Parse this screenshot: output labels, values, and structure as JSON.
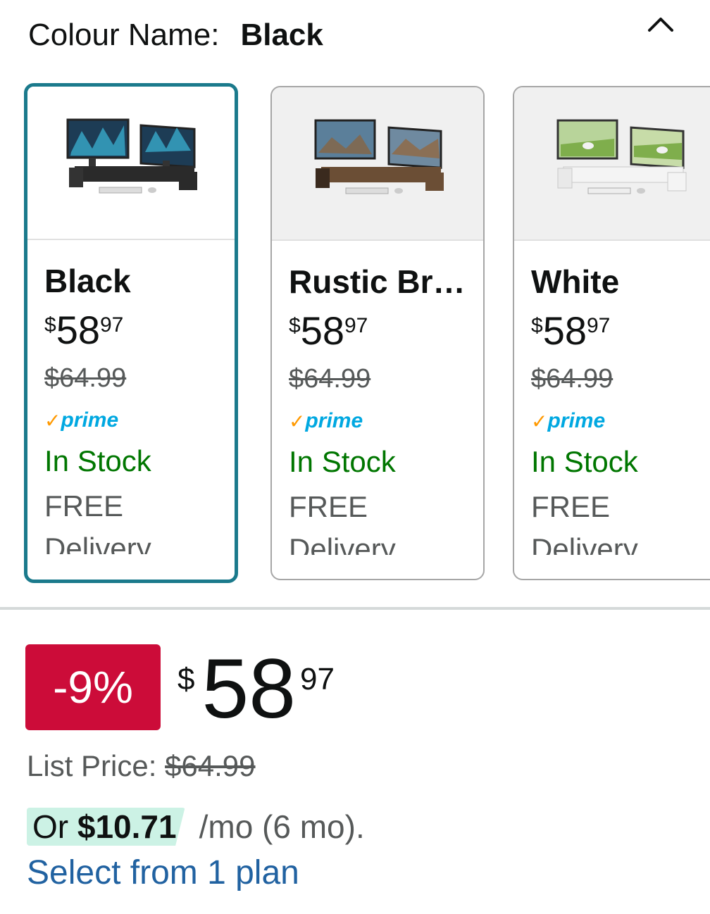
{
  "colour": {
    "label": "Colour Name:",
    "value": "Black"
  },
  "variants": [
    {
      "name": "Black",
      "price_currency": "$",
      "price_whole": "58",
      "price_fraction": "97",
      "list_price": "$64.99",
      "prime_label": "prime",
      "stock": "In Stock",
      "shipping": "FREE",
      "delivery": "Delivery"
    },
    {
      "name": "Rustic Br…",
      "price_currency": "$",
      "price_whole": "58",
      "price_fraction": "97",
      "list_price": "$64.99",
      "prime_label": "prime",
      "stock": "In Stock",
      "shipping": "FREE",
      "delivery": "Delivery"
    },
    {
      "name": "White",
      "price_currency": "$",
      "price_whole": "58",
      "price_fraction": "97",
      "list_price": "$64.99",
      "prime_label": "prime",
      "stock": "In Stock",
      "shipping": "FREE",
      "delivery": "Delivery"
    }
  ],
  "pricing": {
    "discount": "-9%",
    "currency": "$",
    "whole": "58",
    "fraction": "97",
    "list_price_label": "List Price:",
    "list_price": "$64.99"
  },
  "installment": {
    "prefix": "Or",
    "amount": "$10.71",
    "term": "/mo (6 mo)."
  },
  "plan_link": "Select from 1 plan",
  "colors": {
    "selected_border": "#1b7a8c",
    "discount_bg": "#cc0c39",
    "in_stock": "#007600",
    "link": "#2162a1",
    "prime": "#00a8e1",
    "highlight": "#ccf2e5"
  }
}
